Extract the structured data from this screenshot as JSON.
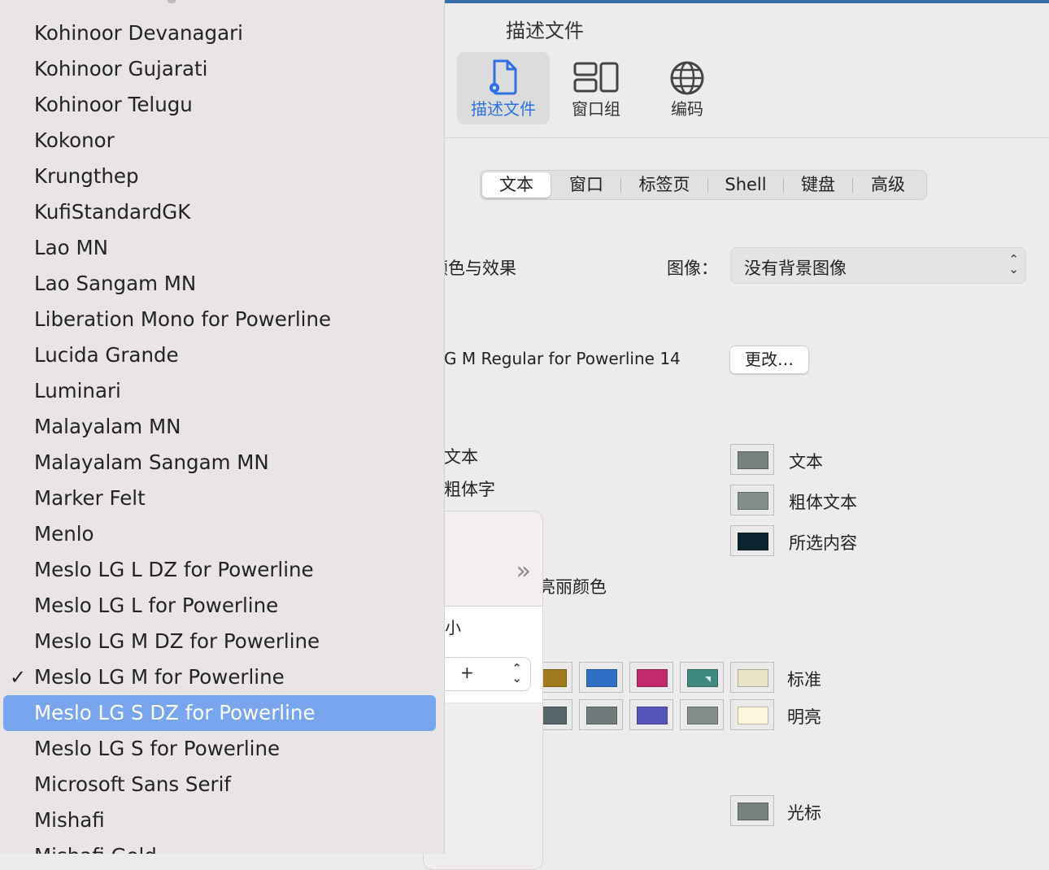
{
  "window": {
    "title": "描述文件",
    "toolbar": [
      {
        "label": "描述文件",
        "icon": "profile-document-gear-icon",
        "active": true
      },
      {
        "label": "窗口组",
        "icon": "window-groups-icon",
        "active": false
      },
      {
        "label": "编码",
        "icon": "globe-icon",
        "active": false
      }
    ]
  },
  "tabs": [
    "文本",
    "窗口",
    "标签页",
    "Shell",
    "键盘",
    "高级"
  ],
  "selected_tab": "文本",
  "settings": {
    "color_effects_label": "颜色与效果",
    "image_label": "图像：",
    "image_value": "没有背景图像",
    "font_value": "G M Regular for Powerline 14",
    "change_button": "更改…",
    "text_label_partial": "文本",
    "bold_label_partial": "粗体字",
    "bright_colors_partial": "亮丽颜色"
  },
  "subpanel": {
    "small_label": "小",
    "stepper_value": "+"
  },
  "color_wells": {
    "text": {
      "label": "文本",
      "color": "#75807f"
    },
    "bold_text": {
      "label": "粗体文本",
      "color": "#848e8d"
    },
    "selection": {
      "label": "所选内容",
      "color": "#0b2430"
    },
    "cursor": {
      "label": "光标",
      "color": "#75807f"
    }
  },
  "ansi": {
    "normal_label": "标准",
    "bright_label": "明亮",
    "normal_colors": [
      "#a07a1c",
      "#2e6fc5",
      "#c4296e",
      "#3e8a82",
      "#e9e3c8"
    ],
    "bright_colors": [
      "#576668",
      "#6e7b7a",
      "#5455b9",
      "#848e8d",
      "#fbf6dc"
    ]
  },
  "font_menu": {
    "items": [
      {
        "label": "Kohinoor Devanagari"
      },
      {
        "label": "Kohinoor Gujarati"
      },
      {
        "label": "Kohinoor Telugu"
      },
      {
        "label": "Kokonor"
      },
      {
        "label": "Krungthep"
      },
      {
        "label": "KufiStandardGK"
      },
      {
        "label": "Lao MN"
      },
      {
        "label": "Lao Sangam MN"
      },
      {
        "label": "Liberation Mono for Powerline"
      },
      {
        "label": "Lucida Grande"
      },
      {
        "label": "Luminari"
      },
      {
        "label": "Malayalam MN"
      },
      {
        "label": "Malayalam Sangam MN"
      },
      {
        "label": "Marker Felt"
      },
      {
        "label": "Menlo"
      },
      {
        "label": "Meslo LG L DZ for Powerline"
      },
      {
        "label": "Meslo LG L for Powerline"
      },
      {
        "label": "Meslo LG M DZ for Powerline"
      },
      {
        "label": "Meslo LG M for Powerline",
        "checked": true
      },
      {
        "label": "Meslo LG S DZ for Powerline",
        "highlighted": true
      },
      {
        "label": "Meslo LG S for Powerline"
      },
      {
        "label": "Microsoft Sans Serif"
      },
      {
        "label": "Mishafi"
      },
      {
        "label": "Mishafi Gold"
      }
    ],
    "checkmark": "✓"
  }
}
